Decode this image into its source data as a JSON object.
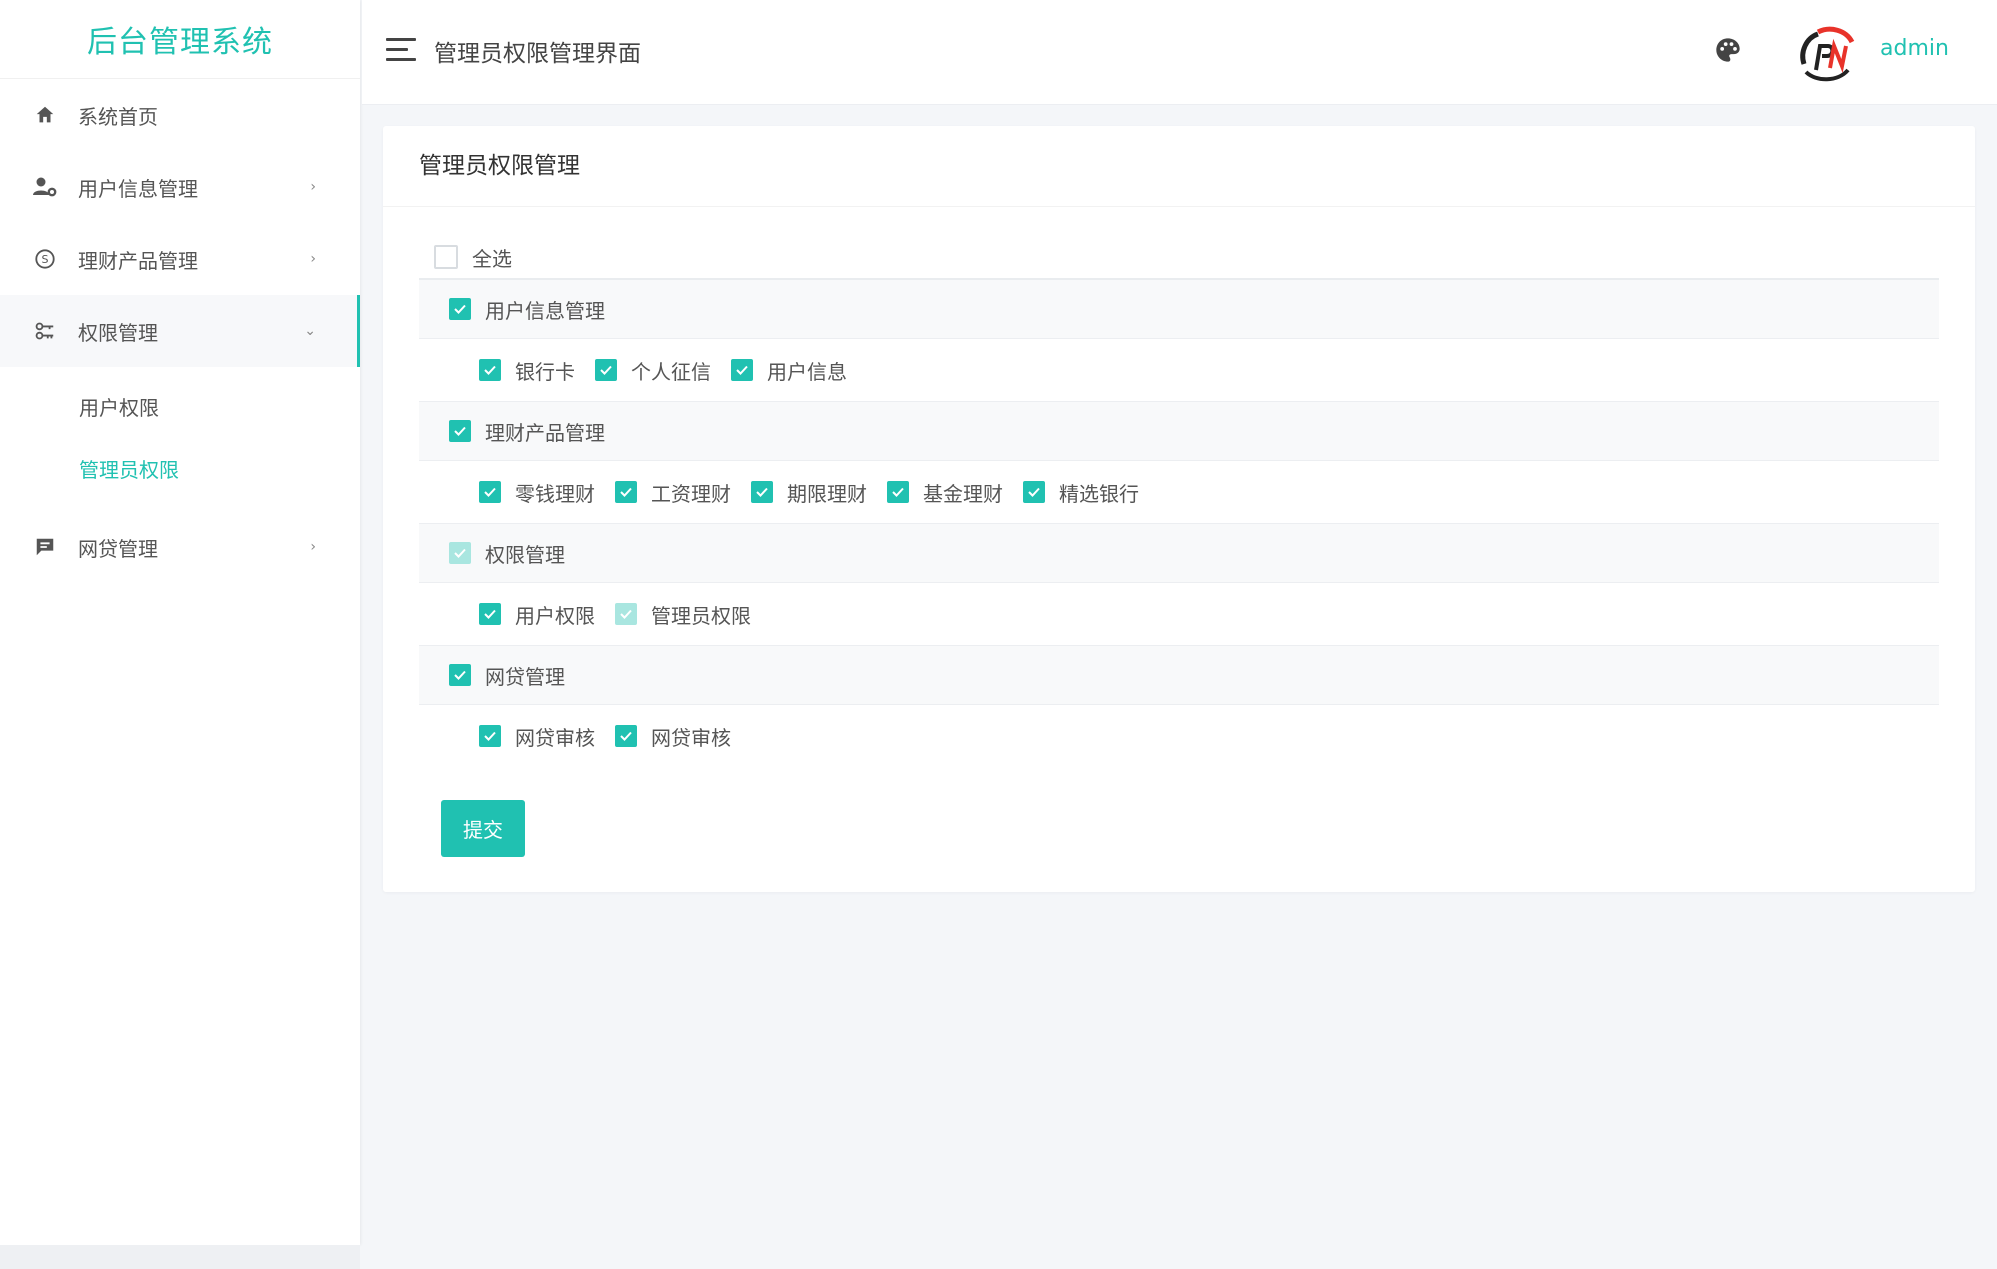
{
  "brand": "后台管理系统",
  "sidebar": {
    "items": [
      {
        "label": "系统首页",
        "icon": "home-icon"
      },
      {
        "label": "用户信息管理",
        "icon": "user-gear-icon"
      },
      {
        "label": "理财产品管理",
        "icon": "coin-icon"
      },
      {
        "label": "权限管理",
        "icon": "key-icon"
      },
      {
        "label": "网贷管理",
        "icon": "message-icon"
      }
    ],
    "submenu": [
      {
        "label": "用户权限"
      },
      {
        "label": "管理员权限"
      }
    ]
  },
  "header": {
    "title": "管理员权限管理界面",
    "username": "admin"
  },
  "card": {
    "title": "管理员权限管理",
    "select_all": "全选",
    "groups": [
      {
        "label": "用户信息管理",
        "children": [
          "银行卡",
          "个人征信",
          "用户信息"
        ]
      },
      {
        "label": "理财产品管理",
        "children": [
          "零钱理财",
          "工资理财",
          "期限理财",
          "基金理财",
          "精选银行"
        ]
      },
      {
        "label": "权限管理",
        "children": [
          "用户权限",
          "管理员权限"
        ]
      },
      {
        "label": "网贷管理",
        "children": [
          "网贷审核",
          "网贷审核"
        ]
      }
    ],
    "submit": "提交"
  },
  "colors": {
    "accent": "#20c1b1"
  }
}
